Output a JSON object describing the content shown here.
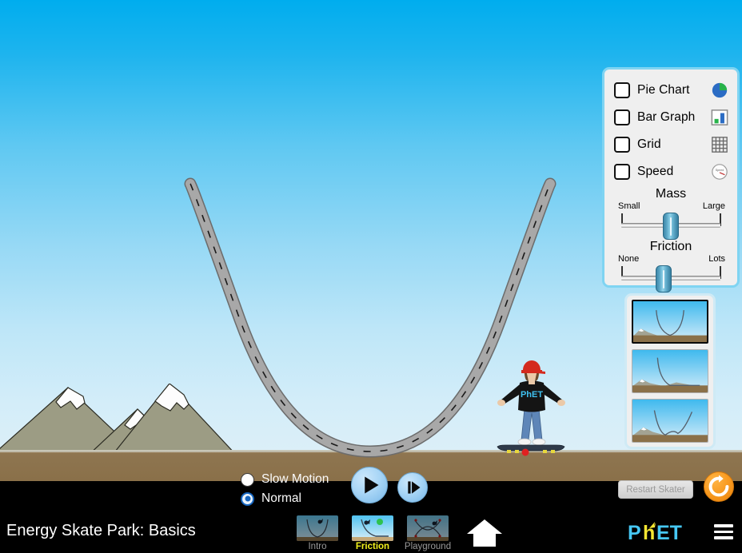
{
  "sim": {
    "title": "Energy Skate Park: Basics",
    "brand": "PhET",
    "sky_top_color": "#00ADEE",
    "sky_bottom_color": "#DCEFF8",
    "ground_color": "#8A7049",
    "mountain_color": "#9C9C84",
    "track_color": "#9A9A9A",
    "accent_yellow": "#F2F21C",
    "reset_orange": "#F89A20"
  },
  "control_panel": {
    "checkboxes": [
      {
        "label": "Pie Chart",
        "checked": false,
        "icon": "pie-chart-icon"
      },
      {
        "label": "Bar Graph",
        "checked": false,
        "icon": "bar-graph-icon"
      },
      {
        "label": "Grid",
        "checked": false,
        "icon": "grid-icon"
      },
      {
        "label": "Speed",
        "checked": false,
        "icon": "speedometer-icon"
      }
    ],
    "sliders": [
      {
        "name": "mass",
        "title": "Mass",
        "min_label": "Small",
        "max_label": "Large",
        "value_percent": 50
      },
      {
        "name": "friction",
        "title": "Friction",
        "min_label": "None",
        "max_label": "Lots",
        "value_percent": 43
      }
    ]
  },
  "track_picker": {
    "options": [
      {
        "name": "parabola-track",
        "label": "Parabola",
        "selected": true
      },
      {
        "name": "ramp-track",
        "label": "Ramp",
        "selected": false
      },
      {
        "name": "double-well-track",
        "label": "Double Well",
        "selected": false
      }
    ]
  },
  "time_controls": {
    "speed_options": [
      {
        "label": "Slow Motion",
        "selected": false
      },
      {
        "label": "Normal",
        "selected": true
      }
    ],
    "play_button": "play-icon",
    "step_button": "step-forward-icon",
    "restart_label": "Restart Skater",
    "restart_enabled": false,
    "reset_all_icon": "reset-all-icon"
  },
  "nav": {
    "tabs": [
      {
        "label": "Intro",
        "active": false
      },
      {
        "label": "Friction",
        "active": true
      },
      {
        "label": "Playground",
        "active": false
      }
    ],
    "home_icon": "home-icon",
    "menu_icon": "hamburger-menu-icon",
    "logo_text_a": "P",
    "logo_text_b": "h",
    "logo_text_c": "ET"
  },
  "skater": {
    "helmet_color": "#D42A1E",
    "shirt_color": "#141414",
    "shirt_text": "PhET",
    "pants_color": "#5E86B8",
    "board_color": "#2F3A4A",
    "wheel_color": "#E8D83C"
  }
}
